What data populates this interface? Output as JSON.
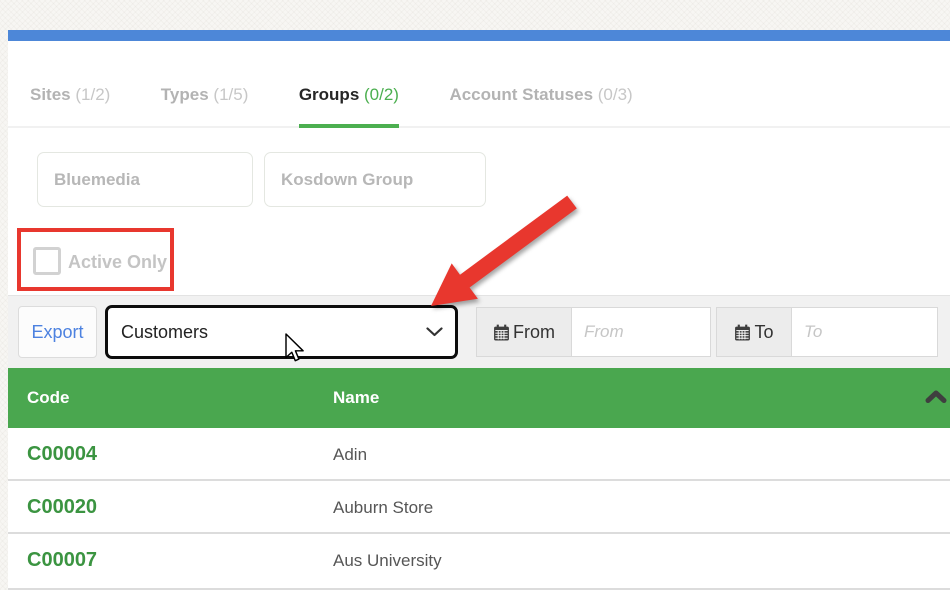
{
  "colors": {
    "top_bar_blue": "#4d87d8",
    "accent_green": "#4caf50",
    "table_header_green": "#4aa74f",
    "code_green": "#3b9441",
    "annotation_red": "#e8372e",
    "export_blue": "#4d82e0"
  },
  "tabs": [
    {
      "label": "Sites",
      "count": "(1/2)",
      "active": false
    },
    {
      "label": "Types",
      "count": "(1/5)",
      "active": false
    },
    {
      "label": "Groups",
      "count": "(0/2)",
      "active": true
    },
    {
      "label": "Account Statuses",
      "count": "(0/3)",
      "active": false
    }
  ],
  "group_options": [
    {
      "label": "Bluemedia"
    },
    {
      "label": "Kosdown Group"
    }
  ],
  "filters": {
    "active_only_label": "Active Only",
    "active_only_checked": false
  },
  "toolbar": {
    "export_label": "Export",
    "entity_select": {
      "value": "Customers"
    },
    "date_from": {
      "label": "From",
      "placeholder": "From",
      "value": ""
    },
    "date_to": {
      "label": "To",
      "placeholder": "To",
      "value": ""
    }
  },
  "table": {
    "columns": [
      "Code",
      "Name"
    ],
    "sort": {
      "column": "Code",
      "direction": "ascending"
    },
    "rows": [
      {
        "code": "C00004",
        "name": "Adin"
      },
      {
        "code": "C00020",
        "name": "Auburn Store"
      },
      {
        "code": "C00007",
        "name": "Aus University"
      }
    ]
  }
}
